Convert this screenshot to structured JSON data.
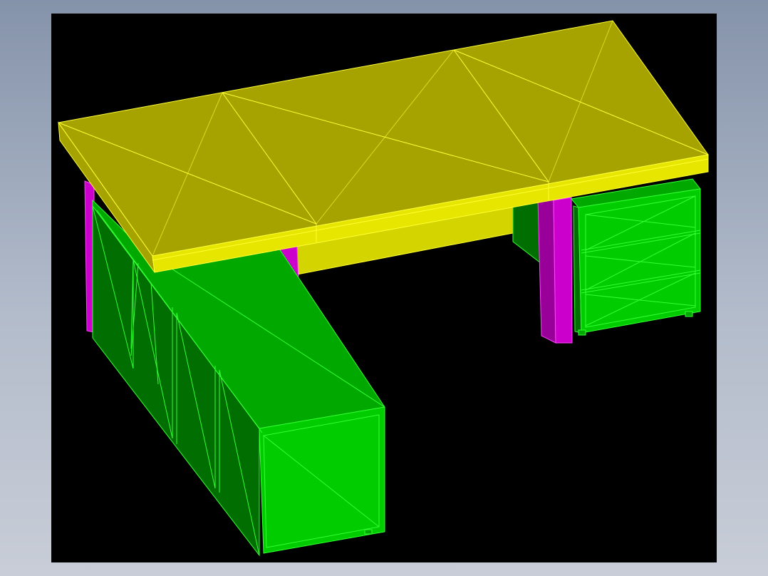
{
  "scene": {
    "background": "#000000",
    "frame_background": "#8f9bb0",
    "colors": {
      "desk_top": "#a6a300",
      "desk_edge": "#e6e600",
      "desk_front": "#d4d400",
      "desk_lines": "#ffff33",
      "legs": "#cc00cc",
      "legs_dark": "#990099",
      "cabinet_top": "#00a800",
      "cabinet_side": "#006e00",
      "cabinet_front": "#00cc00",
      "cabinet_lines": "#33ff33"
    },
    "objects": [
      "desk-top",
      "desk-leg",
      "return-cabinet",
      "drawer-pedestal"
    ]
  }
}
